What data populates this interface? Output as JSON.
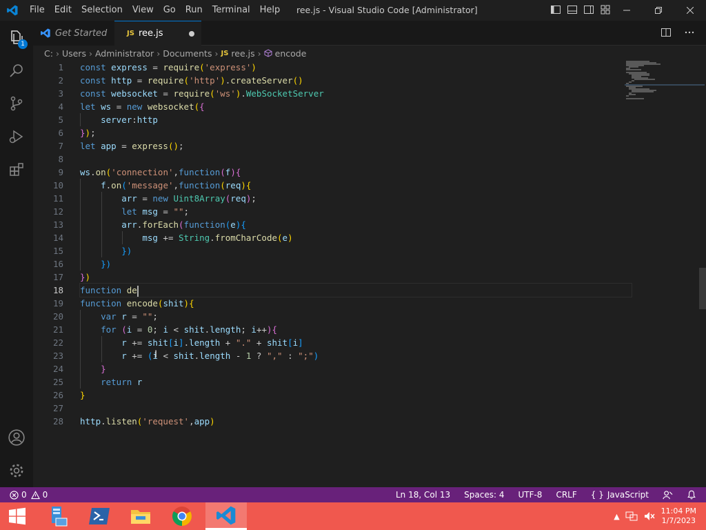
{
  "titlebar": {
    "menu": [
      "File",
      "Edit",
      "Selection",
      "View",
      "Go",
      "Run",
      "Terminal",
      "Help"
    ],
    "window_title": "ree.js - Visual Studio Code [Administrator]"
  },
  "activitybar": {
    "explorer_badge": "1"
  },
  "tabs": [
    {
      "label": "Get Started",
      "active": false
    },
    {
      "label": "ree.js",
      "active": true,
      "dirty": true
    }
  ],
  "file_badge": "JS",
  "breadcrumb": [
    "C:",
    "Users",
    "Administrator",
    "Documents",
    "ree.js",
    "encode"
  ],
  "editor": {
    "active_line": 18,
    "line_numbers": [
      "1",
      "2",
      "3",
      "4",
      "5",
      "6",
      "7",
      "8",
      "9",
      "10",
      "11",
      "12",
      "13",
      "14",
      "15",
      "16",
      "17",
      "18",
      "19",
      "20",
      "21",
      "22",
      "23",
      "24",
      "25",
      "26",
      "27",
      "28"
    ]
  },
  "statusbar": {
    "errors": "0",
    "warnings": "0",
    "position": "Ln 18, Col 13",
    "spaces": "Spaces: 4",
    "encoding": "UTF-8",
    "eol": "CRLF",
    "language": "JavaScript"
  },
  "taskbar": {
    "time": "11:04 PM",
    "date": "1/7/2023"
  },
  "colors": {
    "statusbar": "#68217a",
    "taskbar": "#f0584e",
    "accent": "#0078d4"
  }
}
